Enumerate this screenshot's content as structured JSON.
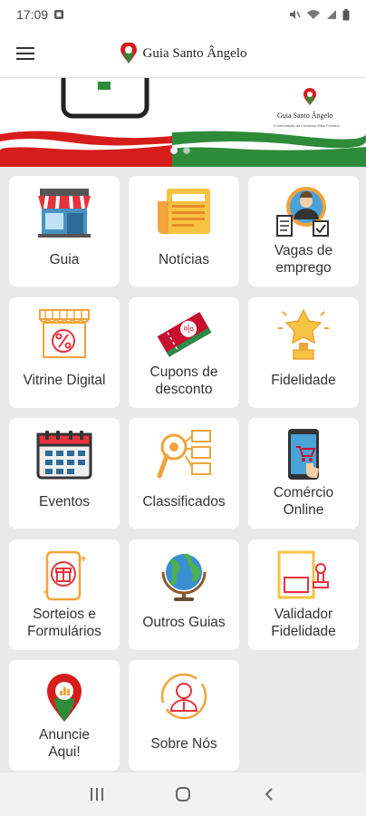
{
  "status_bar": {
    "time": "17:09"
  },
  "app_bar": {
    "title": "Guia Santo Ângelo",
    "menu_icon": "hamburger-menu-icon"
  },
  "banner": {
    "logo_text": "Guia Santo Ângelo",
    "logo_tagline": "A Informação do Comércio Mais Próximo",
    "slides": 2,
    "active_slide": 0,
    "colors": {
      "red": "#d71c1c",
      "green": "#2e8b3a"
    }
  },
  "menu_items": [
    {
      "label": "Guia",
      "icon": "storefront-icon"
    },
    {
      "label": "Notícias",
      "icon": "newspaper-icon"
    },
    {
      "label": "Vagas de\nemprego",
      "icon": "job-candidate-icon"
    },
    {
      "label": "Vitrine Digital",
      "icon": "discount-shop-icon"
    },
    {
      "label": "Cupons de\ndesconto",
      "icon": "coupon-ticket-icon"
    },
    {
      "label": "Fidelidade",
      "icon": "star-trophy-icon"
    },
    {
      "label": "Eventos",
      "icon": "calendar-icon"
    },
    {
      "label": "Classificados",
      "icon": "classifieds-search-icon"
    },
    {
      "label": "Comércio\nOnline",
      "icon": "mobile-shopping-icon"
    },
    {
      "label": "Sorteios e\nFormulários",
      "icon": "gift-phone-icon"
    },
    {
      "label": "Outros Guias",
      "icon": "globe-icon"
    },
    {
      "label": "Validador\nFidelidade",
      "icon": "stamp-validator-icon"
    },
    {
      "label": "Anuncie\nAqui!",
      "icon": "location-pin-chart-icon"
    },
    {
      "label": "Sobre Nós",
      "icon": "about-user-icon"
    }
  ],
  "nav": {
    "recents": "recent-apps-icon",
    "home": "home-icon",
    "back": "back-icon"
  }
}
